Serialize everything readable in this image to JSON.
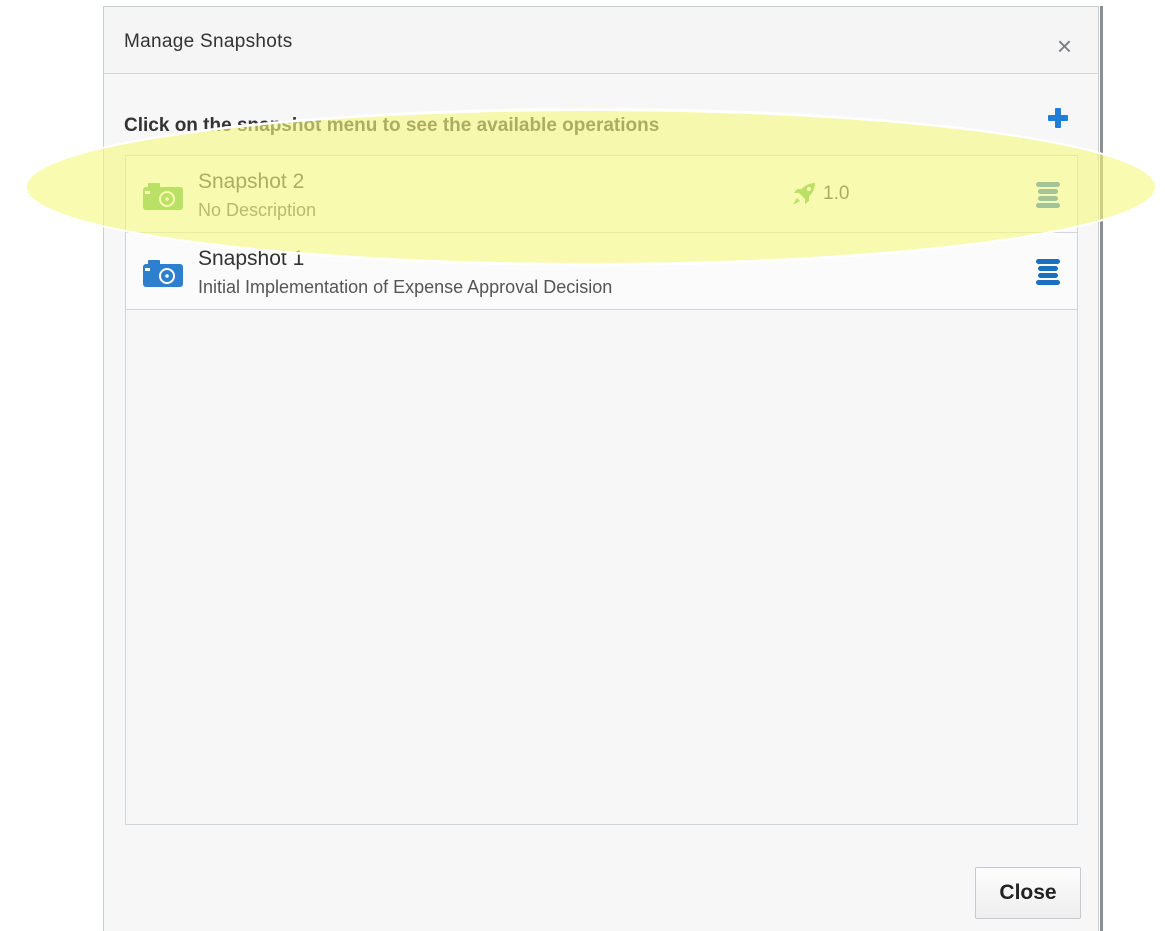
{
  "dialog": {
    "title": "Manage Snapshots",
    "close_x": "×",
    "instruction": "Click on the snapshot menu to see the available operations",
    "close_button_label": "Close"
  },
  "snapshots": [
    {
      "name": "Snapshot 2",
      "description": "No Description",
      "version": "1.0",
      "icon": "camera-icon",
      "icon_color": "#5ab93a",
      "deployed": true
    },
    {
      "name": "Snapshot 1",
      "description": "Initial Implementation of Expense Approval Decision",
      "icon": "camera-icon",
      "icon_color": "#2d7fcf",
      "deployed": false
    }
  ],
  "colors": {
    "accent_blue": "#1f7fd8",
    "menu_blue": "#1a6fbf",
    "highlight": "#f6f880"
  }
}
